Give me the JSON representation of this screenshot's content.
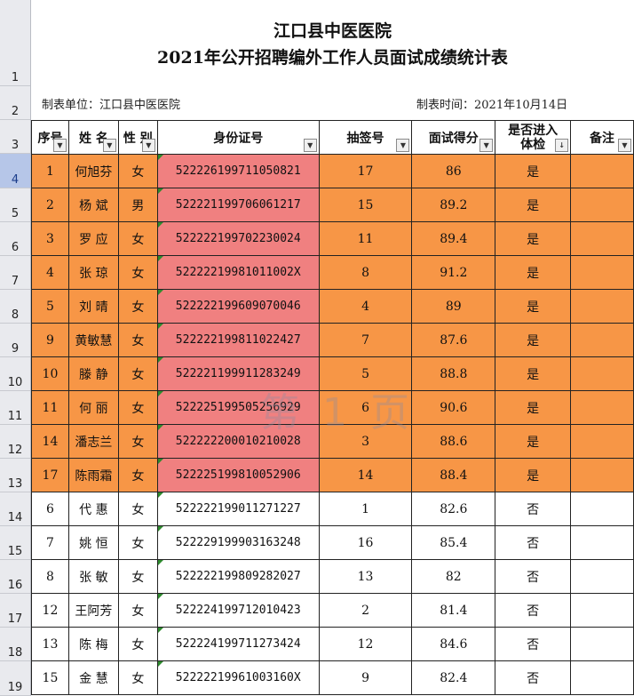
{
  "title": "江口县中医医院",
  "subtitle": "2021年公开招聘编外工作人员面试成绩统计表",
  "unit_label": "制表单位：江口县中医医院",
  "date_label": "制表时间：2021年10月14日",
  "watermark": "第 1 页",
  "row_numbers": [
    "1",
    "2",
    "3",
    "4",
    "5",
    "6",
    "7",
    "8",
    "9",
    "10",
    "11",
    "12",
    "13",
    "14",
    "15",
    "16",
    "17",
    "18",
    "19"
  ],
  "selected_row_number": "4",
  "headers": {
    "seq": "序号",
    "name": "姓 名",
    "gender": "性 别",
    "id": "身份证号",
    "lot": "抽签号",
    "score": "面试得分",
    "exam_line1": "是否进入",
    "exam_line2": "体检",
    "note": "备注"
  },
  "rows": [
    {
      "seq": "1",
      "name": "何旭芬",
      "gender": "女",
      "id": "522226199711050821",
      "lot": "17",
      "score": "86",
      "exam": "是",
      "highlight": true
    },
    {
      "seq": "2",
      "name": "杨 斌",
      "gender": "男",
      "id": "522221199706061217",
      "lot": "15",
      "score": "89.2",
      "exam": "是",
      "highlight": true
    },
    {
      "seq": "3",
      "name": "罗 应",
      "gender": "女",
      "id": "522222199702230024",
      "lot": "11",
      "score": "89.4",
      "exam": "是",
      "highlight": true
    },
    {
      "seq": "4",
      "name": "张 琼",
      "gender": "女",
      "id": "52222219981011002X",
      "lot": "8",
      "score": "91.2",
      "exam": "是",
      "highlight": true
    },
    {
      "seq": "5",
      "name": "刘 晴",
      "gender": "女",
      "id": "522222199609070046",
      "lot": "4",
      "score": "89",
      "exam": "是",
      "highlight": true
    },
    {
      "seq": "9",
      "name": "黄敏慧",
      "gender": "女",
      "id": "522222199811022427",
      "lot": "7",
      "score": "87.6",
      "exam": "是",
      "highlight": true
    },
    {
      "seq": "10",
      "name": "滕 静",
      "gender": "女",
      "id": "522221199911283249",
      "lot": "5",
      "score": "88.8",
      "exam": "是",
      "highlight": true
    },
    {
      "seq": "11",
      "name": "何 丽",
      "gender": "女",
      "id": "522225199505256929",
      "lot": "6",
      "score": "90.6",
      "exam": "是",
      "highlight": true
    },
    {
      "seq": "14",
      "name": "潘志兰",
      "gender": "女",
      "id": "522222200010210028",
      "lot": "3",
      "score": "88.6",
      "exam": "是",
      "highlight": true
    },
    {
      "seq": "17",
      "name": "陈雨霜",
      "gender": "女",
      "id": "522225199810052906",
      "lot": "14",
      "score": "88.4",
      "exam": "是",
      "highlight": true
    },
    {
      "seq": "6",
      "name": "代 惠",
      "gender": "女",
      "id": "522222199011271227",
      "lot": "1",
      "score": "82.6",
      "exam": "否",
      "highlight": false
    },
    {
      "seq": "7",
      "name": "姚 恒",
      "gender": "女",
      "id": "522229199903163248",
      "lot": "16",
      "score": "85.4",
      "exam": "否",
      "highlight": false
    },
    {
      "seq": "8",
      "name": "张 敏",
      "gender": "女",
      "id": "522222199809282027",
      "lot": "13",
      "score": "82",
      "exam": "否",
      "highlight": false
    },
    {
      "seq": "12",
      "name": "王阿芳",
      "gender": "女",
      "id": "522224199712010423",
      "lot": "2",
      "score": "81.4",
      "exam": "否",
      "highlight": false
    },
    {
      "seq": "13",
      "name": "陈 梅",
      "gender": "女",
      "id": "522224199711273424",
      "lot": "12",
      "score": "84.6",
      "exam": "否",
      "highlight": false
    },
    {
      "seq": "15",
      "name": "金 慧",
      "gender": "女",
      "id": "52222219961003160X",
      "lot": "9",
      "score": "82.4",
      "exam": "否",
      "highlight": false
    }
  ],
  "colors": {
    "highlight_row": "#f79646",
    "highlight_id": "#f08080",
    "selected_row_header": "#b6c6e8"
  }
}
